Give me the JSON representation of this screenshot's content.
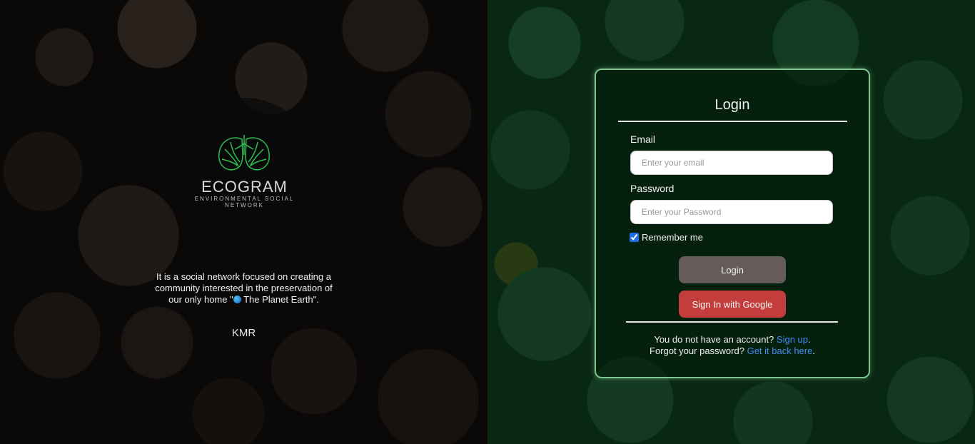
{
  "brand": {
    "name": "ECOGRAM",
    "tagline": "ENVIRONMENTAL SOCIAL NETWORK",
    "logo_icon": "lungs-leaf-icon",
    "logo_color": "#2fbf4f"
  },
  "intro": {
    "description_prefix": "It is a social network focused on creating a community interested in the preservation of our only home \"",
    "earth_icon": "earth-globe-icon",
    "description_suffix": " The Planet Earth\".",
    "author": "KMR"
  },
  "login": {
    "title": "Login",
    "email_label": "Email",
    "email_placeholder": "Enter your email",
    "password_label": "Password",
    "password_placeholder": "Enter your Password",
    "remember_label": "Remember me",
    "remember_checked": true,
    "login_button": "Login",
    "google_button": "Sign In with Google",
    "signup_prompt": "You do not have an account?",
    "signup_link": "Sign up",
    "signup_suffix": ".",
    "forgot_prompt": "Forgot your password?",
    "forgot_link": "Get it back here",
    "forgot_suffix": "."
  },
  "colors": {
    "card_border": "#7ec58f",
    "login_button_bg": "#655b5b",
    "google_button_bg": "#c43d3d",
    "link": "#3e8df5"
  }
}
